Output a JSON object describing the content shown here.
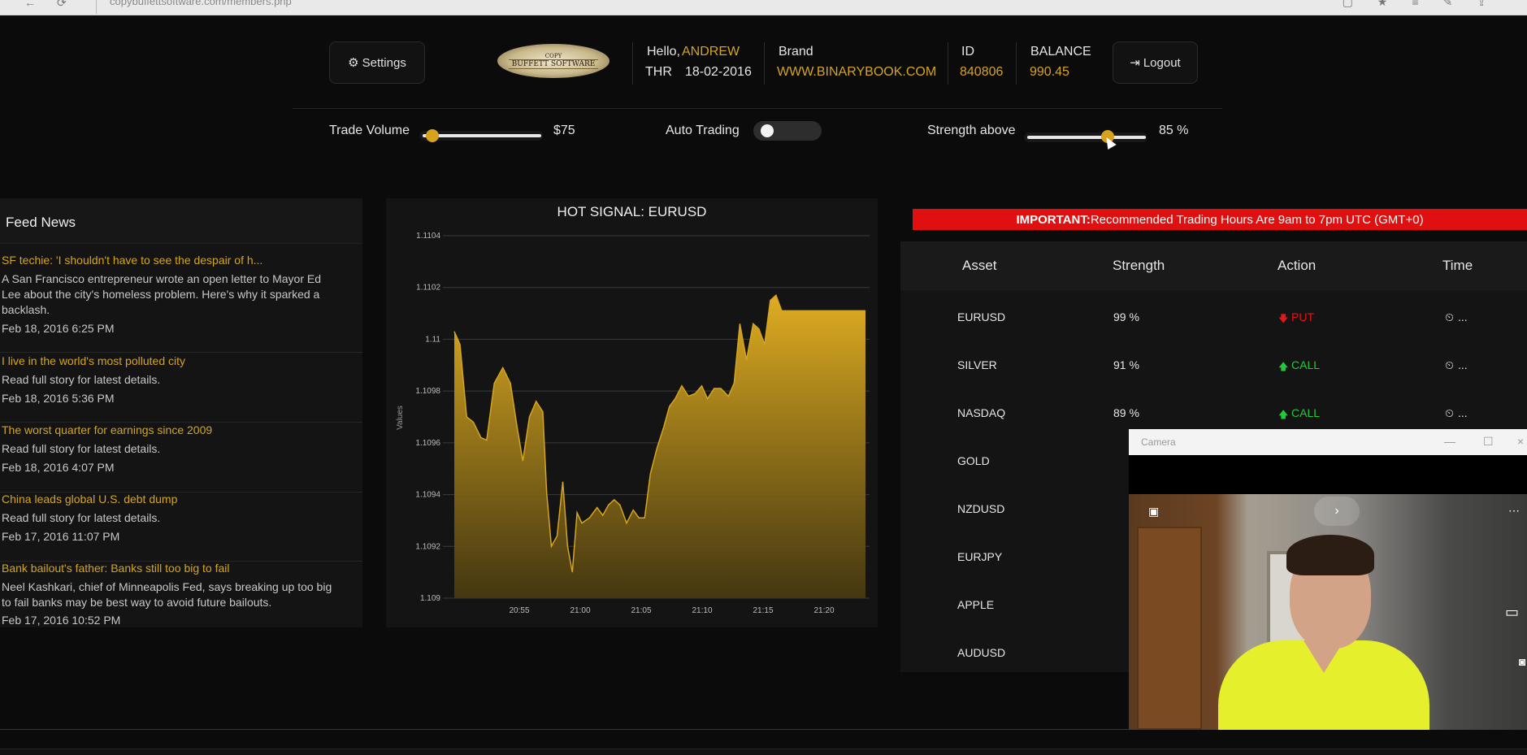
{
  "browser": {
    "url": "copybuffettsoftware.com/members.php",
    "icons": [
      "back-icon",
      "reload-icon",
      "reading-view-icon",
      "favorite-icon",
      "hub-icon",
      "notes-icon",
      "share-icon"
    ]
  },
  "header": {
    "settings_label": "Settings",
    "logo_top": "COPY",
    "logo_bottom": "BUFFETT SOFTWARE",
    "hello_label": "Hello,",
    "user_name": "ANDREW",
    "day": "THR",
    "date": "18-02-2016",
    "brand_label": "Brand",
    "brand_value": "WWW.BINARYBOOK.COM",
    "id_label": "ID",
    "id_value": "840806",
    "balance_label": "BALANCE",
    "balance_value": "990.45",
    "logout_label": "Logout"
  },
  "controls": {
    "trade_volume_label": "Trade Volume",
    "trade_volume_value": "$75",
    "trade_volume_fraction": 0.08,
    "auto_trading_label": "Auto Trading",
    "auto_trading_on": false,
    "strength_label": "Strength above",
    "strength_value": "85 %",
    "strength_fraction": 0.68
  },
  "feed": {
    "title": "Feed News",
    "items": [
      {
        "title": "SF techie: 'I shouldn't have to see the despair of h...",
        "desc": "A San Francisco entrepreneur wrote an open letter to Mayor Ed Lee about the city's homeless problem. Here's why it sparked a backlash.",
        "date": "Feb 18, 2016 6:25 PM"
      },
      {
        "title": "I live in the world's most polluted city",
        "desc": "Read full story for latest details.",
        "date": "Feb 18, 2016 5:36 PM"
      },
      {
        "title": "The worst quarter for earnings since 2009",
        "desc": "Read full story for latest details.",
        "date": "Feb 18, 2016 4:07 PM"
      },
      {
        "title": "China leads global U.S. debt dump",
        "desc": "Read full story for latest details.",
        "date": "Feb 17, 2016 11:07 PM"
      },
      {
        "title": "Bank bailout's father: Banks still too big to fail",
        "desc": "Neel Kashkari, chief of Minneapolis Fed, says breaking up too big to fail banks may be best way to avoid future bailouts.",
        "date": "Feb 17, 2016 10:52 PM"
      }
    ]
  },
  "chart_data": {
    "type": "area",
    "title": "HOT SIGNAL: EURUSD",
    "ylabel": "Values",
    "xlabel": "",
    "ylim": [
      1.109,
      1.1104
    ],
    "yticks": [
      "1.1104",
      "1.1102",
      "1.11",
      "1.1098",
      "1.1096",
      "1.1094",
      "1.1092",
      "1.109"
    ],
    "xticks": [
      "20:55",
      "21:00",
      "21:05",
      "21:10",
      "21:15",
      "21:20"
    ],
    "xrange_min": [
      20.83,
      21.39
    ],
    "x": [
      0,
      0.6,
      1.3,
      2,
      2.8,
      3.4,
      4.2,
      5.1,
      5.9,
      6.6,
      7.2,
      7.9,
      8.6,
      9.3,
      9.7,
      10.2,
      10.8,
      11.4,
      11.9,
      12.4,
      12.9,
      13.4,
      14.2,
      15,
      15.6,
      16.2,
      16.8,
      17.4,
      18.1,
      18.8,
      19.4,
      20,
      20.6,
      21.3,
      22,
      22.6,
      23.2,
      23.9,
      24.6,
      25.3,
      26,
      26.6,
      27.3,
      28,
      28.8,
      29.4,
      30,
      30.7,
      31.4,
      32,
      32.6,
      33.2,
      33.8,
      34.4,
      35,
      35.6,
      36.2,
      36.9,
      37.6,
      38.2,
      39,
      39.6,
      40.2,
      40.8,
      41.5,
      42,
      42.6,
      43.2
    ],
    "values": [
      1.11003,
      1.10998,
      1.1097,
      1.10968,
      1.10962,
      1.10961,
      1.10983,
      1.10989,
      1.10983,
      1.10966,
      1.10953,
      1.1097,
      1.10976,
      1.10972,
      1.10941,
      1.1092,
      1.10924,
      1.10945,
      1.1092,
      1.1091,
      1.10933,
      1.10929,
      1.10931,
      1.10935,
      1.10932,
      1.10936,
      1.10938,
      1.10936,
      1.10929,
      1.10934,
      1.10931,
      1.10931,
      1.10948,
      1.10958,
      1.10966,
      1.10974,
      1.10977,
      1.10982,
      1.10978,
      1.10979,
      1.10982,
      1.10977,
      1.10981,
      1.10981,
      1.10978,
      1.10983,
      1.11006,
      1.10992,
      1.11006,
      1.11004,
      1.10998,
      1.11015,
      1.11017,
      1.11011,
      1.11011,
      1.11011,
      1.11011,
      1.11011,
      1.11011,
      1.11011,
      1.11011,
      1.11011,
      1.11011,
      1.11011,
      1.11011,
      1.11011,
      1.11011,
      1.11011
    ],
    "grid": true,
    "color": "#d4a51f"
  },
  "signals": {
    "important_label": "IMPORTANT:",
    "important_text": "Recommended Trading Hours Are 9am to 7pm UTC (GMT+0)",
    "columns": [
      "Asset",
      "Strength",
      "Action",
      "Time"
    ],
    "rows": [
      {
        "asset": "EURUSD",
        "strength": "99 %",
        "action": "PUT",
        "time": "..."
      },
      {
        "asset": "SILVER",
        "strength": "91 %",
        "action": "CALL",
        "time": "..."
      },
      {
        "asset": "NASDAQ",
        "strength": "89 %",
        "action": "CALL",
        "time": "..."
      },
      {
        "asset": "GOLD",
        "strength": "",
        "action": "",
        "time": ""
      },
      {
        "asset": "NZDUSD",
        "strength": "",
        "action": "",
        "time": ""
      },
      {
        "asset": "EURJPY",
        "strength": "",
        "action": "",
        "time": ""
      },
      {
        "asset": "APPLE",
        "strength": "",
        "action": "",
        "time": ""
      },
      {
        "asset": "AUDUSD",
        "strength": "",
        "action": "",
        "time": ""
      }
    ]
  },
  "camera": {
    "title": "Camera",
    "next_glyph": "›"
  },
  "colors": {
    "accent": "#d4a51f",
    "put": "#e11818",
    "call": "#23c93c",
    "banner": "#e11010"
  }
}
